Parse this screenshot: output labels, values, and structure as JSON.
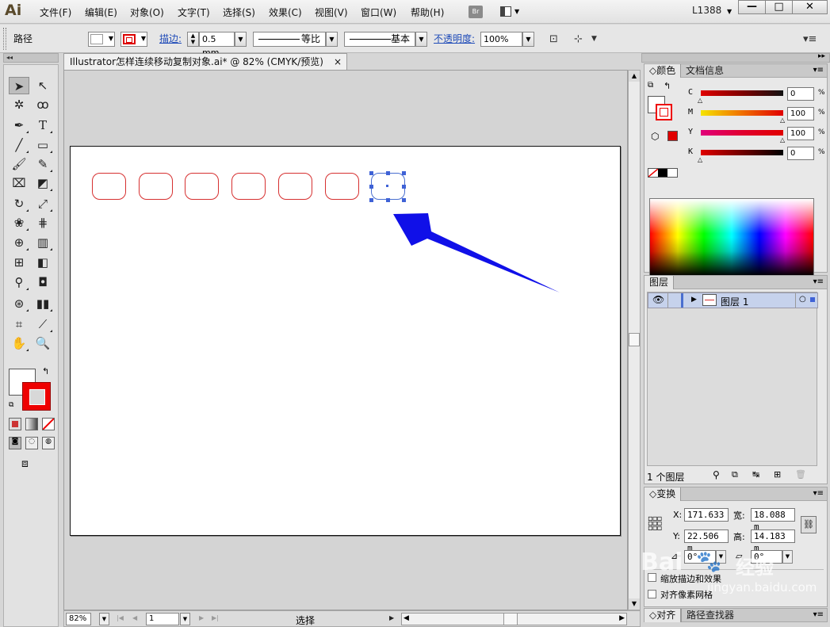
{
  "app": {
    "logo": "Ai",
    "menus": [
      "文件(F)",
      "编辑(E)",
      "对象(O)",
      "文字(T)",
      "选择(S)",
      "效果(C)",
      "视图(V)",
      "窗口(W)",
      "帮助(H)"
    ],
    "bridge_label": "Br",
    "workspace": "L1388",
    "window_buttons": [
      "—",
      "□",
      "✕"
    ]
  },
  "control": {
    "selection_type": "路径",
    "stroke_label": "描边:",
    "stroke_weight": "0.5 mm",
    "stroke_profile": "等比",
    "brush": "基本",
    "opacity_label": "不透明度:",
    "opacity_value": "100%"
  },
  "document": {
    "tab_title": "Illustrator怎样连续移动复制对象.ai* @ 82% (CMYK/预览)",
    "tab_close": "×",
    "zoom": "82%",
    "artboard_number": "1",
    "status_label": "选择",
    "shape_count": 7,
    "selected_index": 6,
    "colors": {
      "shape_stroke": "#d63030",
      "selection": "#4a6fd0",
      "arrow": "#1010e8"
    }
  },
  "color_panel": {
    "tabs": [
      "颜色",
      "文档信息"
    ],
    "sliders": [
      {
        "label": "C",
        "value": "0",
        "gradient": "linear-gradient(to right,#e00000,#800000,#111)"
      },
      {
        "label": "M",
        "value": "100",
        "gradient": "linear-gradient(to right,#f5e400,#f07000,#e00000)"
      },
      {
        "label": "Y",
        "value": "100",
        "gradient": "linear-gradient(to right,#e0007a,#e00030,#e00000)"
      },
      {
        "label": "K",
        "value": "0",
        "gradient": "linear-gradient(to right,#e00000,#700000,#000)"
      }
    ],
    "percent": "%",
    "current_stroke_color": "#e00000"
  },
  "layers_panel": {
    "tab": "图层",
    "layer_name": "图层 1",
    "count_label": "1 个图层"
  },
  "transform_panel": {
    "tab": "变换",
    "x_label": "X:",
    "x": "171.633",
    "y_label": "Y:",
    "y": "22.506 m",
    "w_label": "宽:",
    "w": "18.088 m",
    "h_label": "高:",
    "h": "14.183 m",
    "rotate": "0°",
    "shear": "0°",
    "opt1": "缩放描边和效果",
    "opt2": "对齐像素网格"
  },
  "bottom_tabs": [
    "对齐",
    "路径查找器"
  ],
  "watermark": {
    "brand": "Bai",
    "brand2": "经验",
    "url": "jingyan.baidu.com"
  }
}
